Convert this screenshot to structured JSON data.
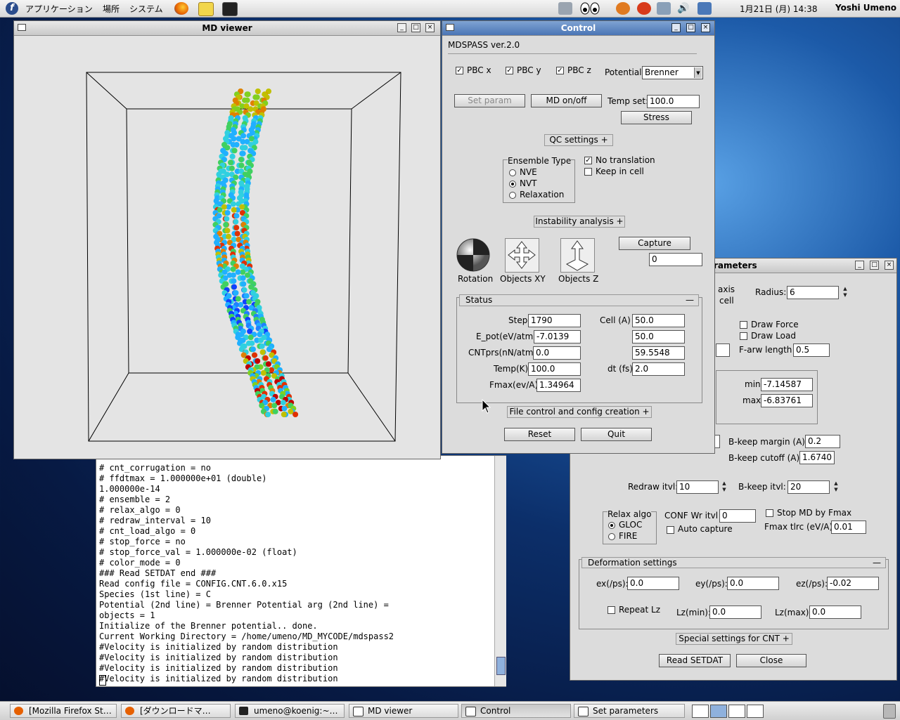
{
  "top_panel": {
    "menus": [
      "アプリケーション",
      "場所",
      "システム"
    ],
    "clock": "1月21日 (月) 14:38",
    "user": "Yoshi Umeno"
  },
  "md_viewer": {
    "title": "MD viewer"
  },
  "terminal": {
    "lines": [
      "# cnt_corrugation = no",
      "# ffdtmax = 1.000000e+01 (double)",
      "1.000000e-14",
      "# ensemble = 2",
      "# relax_algo = 0",
      "# redraw_interval = 10",
      "# cnt_load_algo = 0",
      "# stop_force = no",
      "# stop_force_val = 1.000000e-02 (float)",
      "# color_mode = 0",
      "### Read SETDAT end ###",
      "Read config file = CONFIG.CNT.6.0.x15",
      "Species (1st line) = C",
      "Potential (2nd line) = Brenner Potential arg (2nd line) =",
      "objects = 1",
      "Initialize of the Brenner potential.. done.",
      "Current Working Directory = /home/umeno/MD_MYCODE/mdspass2",
      "#Velocity is initialized by random distribution",
      "#Velocity is initialized by random distribution",
      "#Velocity is initialized by random distribution",
      "#Velocity is initialized by random distribution"
    ]
  },
  "control": {
    "title": "Control",
    "app_name": "MDSPASS ver.2.0",
    "pbc_x": "PBC x",
    "pbc_y": "PBC y",
    "pbc_z": "PBC z",
    "potential_label": "Potential:",
    "potential_value": "Brenner",
    "set_param": "Set param",
    "md_onoff": "MD on/off",
    "temp_set_label": "Temp set:",
    "temp_set_value": "100.0",
    "stress": "Stress",
    "qc_settings": "QC settings +",
    "ensemble_title": "Ensemble Type",
    "nve": "NVE",
    "nvt": "NVT",
    "relaxation": "Relaxation",
    "no_translation": "No translation",
    "keep_in_cell": "Keep in cell",
    "instability": "Instability analysis +",
    "capture": "Capture",
    "capture_value": "0",
    "rotation": "Rotation",
    "objects_xy": "Objects XY",
    "objects_z": "Objects Z",
    "status": {
      "title": "Status",
      "collapse": "—",
      "step_label": "Step",
      "step": "1790",
      "epot_label": "E_pot(eV/atm)",
      "epot": "-7.0139",
      "cntprs_label": "CNTprs(nN/atm)",
      "cntprs": "0.0",
      "temp_label": "Temp(K)",
      "temp": "100.0",
      "fmax_label": "Fmax(ev/A)",
      "fmax": "1.34964",
      "cell_label": "Cell (A)",
      "cell_x": "50.0",
      "cell_y": "50.0",
      "cell_z": "59.5548",
      "dt_label": "dt (fs)",
      "dt": "2.0"
    },
    "file_control": "File control and config creation +",
    "reset": "Reset",
    "quit": "Quit"
  },
  "set_params": {
    "title_visible": "rameters",
    "axis": "axis",
    "cell": "cell",
    "radius_label": "Radius:",
    "radius": "6",
    "draw_force": "Draw Force",
    "draw_load": "Draw Load",
    "farw_label": "F-arw length",
    "farw": "0.5",
    "min_label": "min",
    "min": "-7.14587",
    "max_label": "max",
    "max": "-6.83761",
    "bkeep_margin_label": "B-keep margin (A)",
    "bkeep_margin": "0.2",
    "bkeep_cutoff_label": "B-keep cutoff (A)",
    "bkeep_cutoff": "1.6740",
    "redraw_label": "Redraw itvl:",
    "redraw": "10",
    "bkeep_itvl_label": "B-keep itvl:",
    "bkeep_itvl": "20",
    "relax_algo_title": "Relax algo",
    "gloc": "GLOC",
    "fire": "FIRE",
    "conf_wr_label": "CONF Wr itvl",
    "conf_wr": "0",
    "auto_capture": "Auto capture",
    "stop_md": "Stop MD by Fmax",
    "fmax_tlrc_label": "Fmax tlrc (eV/A)",
    "fmax_tlrc": "0.01",
    "deformation_title": "Deformation settings",
    "ex_label": "ex(/ps):",
    "ex": "0.0",
    "ey_label": "ey(/ps):",
    "ey": "0.0",
    "ez_label": "ez(/ps):",
    "ez": "-0.02",
    "repeat_lz": "Repeat Lz",
    "lzmin_label": "Lz(min):",
    "lzmin": "0.0",
    "lzmax_label": "Lz(max):",
    "lzmax": "0.0",
    "special": "Special settings for CNT +",
    "read_setdat": "Read SETDAT",
    "close": "Close"
  },
  "taskbar": {
    "tasks": [
      "[Mozilla Firefox St…",
      "[ダウンロードマ…",
      "umeno@koenig:~…",
      "MD viewer",
      "Control",
      "Set parameters"
    ]
  }
}
